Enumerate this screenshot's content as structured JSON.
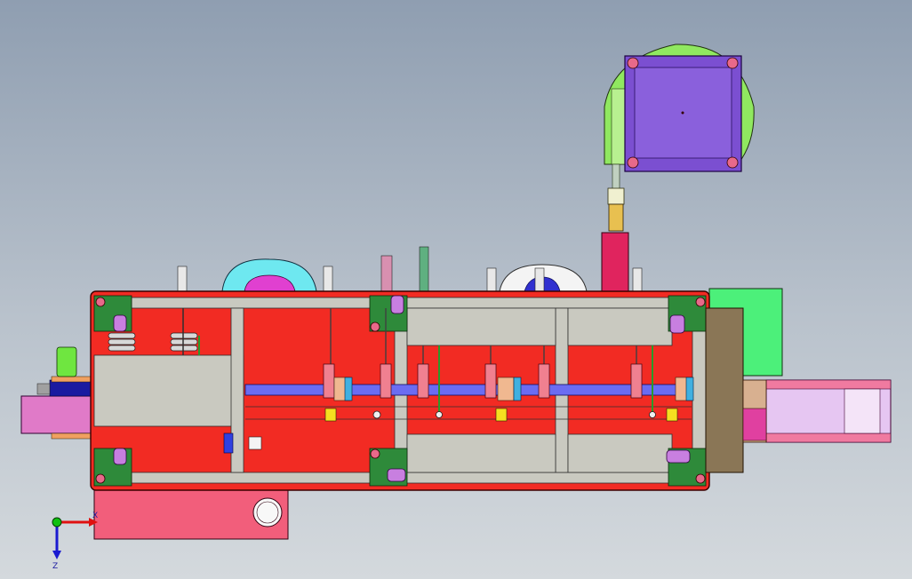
{
  "viewport": {
    "background_top": "#8f9eb1",
    "background_bottom": "#d4d9dd"
  },
  "colors": {
    "frame_red": "#f22b23",
    "frame_outline": "#3a0000",
    "plate_grey": "#c9c9c0",
    "corner_green": "#2e8a3a",
    "bolt_pink": "#e8698a",
    "roller_violet": "#c87fe0",
    "rail_blue": "#6b6cf2",
    "motor_purple": "#7b4fd1",
    "bracket_green": "#90e860",
    "box_green": "#4cf07a",
    "wall_brown": "#8a7656",
    "base_pink": "#f25e7b",
    "side_magenta": "#e07ac8",
    "chute_lavender": "#e6c6f2",
    "column_crimson": "#e0245e",
    "small_yellow": "#f5e020",
    "motor_green": "#6fe640",
    "cyan_wheel": "#6ee8f0"
  },
  "axes": {
    "x_label": "X",
    "z_label": "Z",
    "x_color": "#e01010",
    "z_color": "#1a1ad0",
    "y_color": "#10c010"
  }
}
